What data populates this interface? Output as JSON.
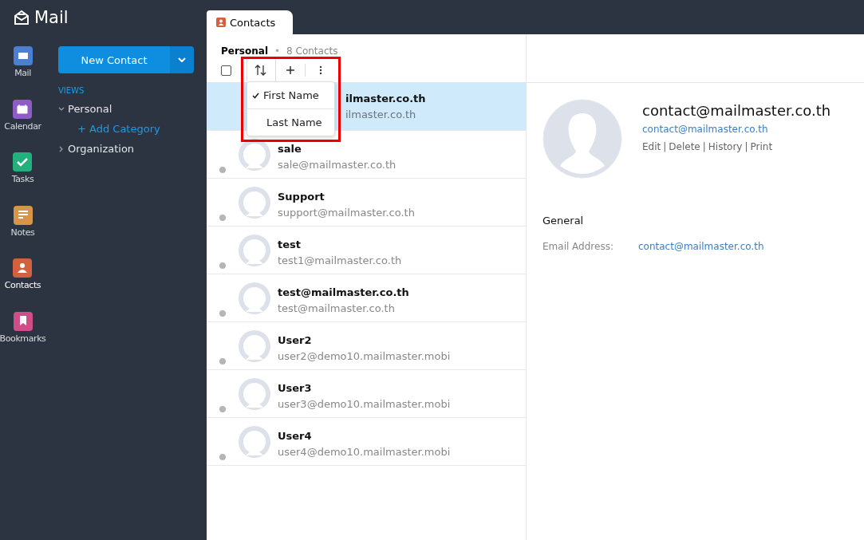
{
  "app": {
    "title": "Mail"
  },
  "rail": [
    {
      "label": "Mail",
      "kind": "mail",
      "color": "#4a7fd4",
      "selected": false
    },
    {
      "label": "Calendar",
      "kind": "calendar",
      "color": "#8e5cc4",
      "selected": false
    },
    {
      "label": "Tasks",
      "kind": "tasks",
      "color": "#22b07d",
      "selected": false
    },
    {
      "label": "Notes",
      "kind": "notes",
      "color": "#d7954a",
      "selected": false
    },
    {
      "label": "Contacts",
      "kind": "contacts",
      "color": "#d2613f",
      "selected": true
    },
    {
      "label": "Bookmarks",
      "kind": "bookmarks",
      "color": "#d04d8a",
      "selected": false
    }
  ],
  "new_button": "New Contact",
  "views": {
    "heading": "VIEWS",
    "items": [
      {
        "label": "Personal",
        "expanded": true,
        "children": [
          {
            "label": "+ Add Category"
          }
        ]
      },
      {
        "label": "Organization",
        "expanded": false
      }
    ]
  },
  "tab": {
    "label": "Contacts"
  },
  "list_header": {
    "title": "Personal",
    "separator": "•",
    "count": "8 Contacts",
    "select_all_checked": false
  },
  "sort_menu": {
    "items": [
      {
        "label": "First Name",
        "checked": true
      },
      {
        "label": "Last Name",
        "checked": false
      }
    ]
  },
  "contacts": [
    {
      "name": "ilmaster.co.th",
      "email": "ilmaster.co.th",
      "selected": true,
      "covered": true
    },
    {
      "name": "sale",
      "email": "sale@mailmaster.co.th",
      "selected": false,
      "covered": false
    },
    {
      "name": "Support",
      "email": "support@mailmaster.co.th",
      "selected": false,
      "covered": false
    },
    {
      "name": "test",
      "email": "test1@mailmaster.co.th",
      "selected": false,
      "covered": false
    },
    {
      "name": "test@mailmaster.co.th",
      "email": "test@mailmaster.co.th",
      "selected": false,
      "covered": false
    },
    {
      "name": "User2",
      "email": "user2@demo10.mailmaster.mobi",
      "selected": false,
      "covered": false
    },
    {
      "name": "User3",
      "email": "user3@demo10.mailmaster.mobi",
      "selected": false,
      "covered": false
    },
    {
      "name": "User4",
      "email": "user4@demo10.mailmaster.mobi",
      "selected": false,
      "covered": false
    }
  ],
  "detail": {
    "name": "contact@mailmaster.co.th",
    "email": "contact@mailmaster.co.th",
    "actions": [
      "Edit",
      "Delete",
      "History",
      "Print"
    ],
    "separator": "|",
    "section": "General",
    "fields": [
      {
        "label": "Email Address:",
        "value": "contact@mailmaster.co.th"
      }
    ]
  }
}
